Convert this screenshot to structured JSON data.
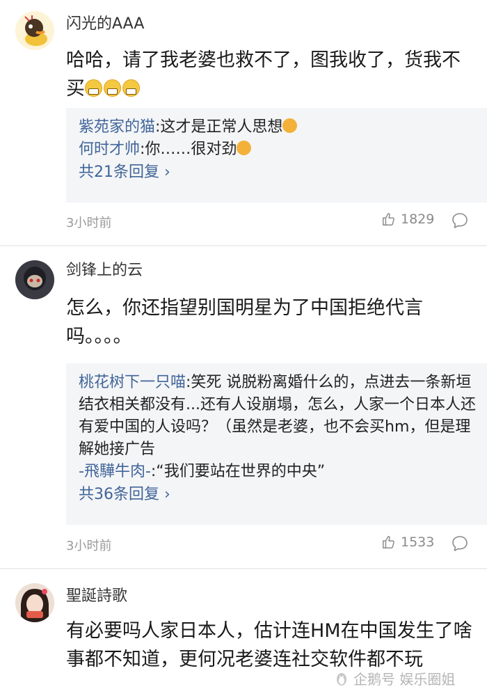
{
  "comments": [
    {
      "username": "闪光的AAA",
      "content": "哈哈，请了我老婆也救不了，图我收了，货我不买",
      "replies": [
        {
          "user": "紫苑家的猫",
          "text": ":这才是正常人思想"
        },
        {
          "user": "何时才帅",
          "text": ":你……很对劲"
        }
      ],
      "more_replies": "共21条回复",
      "time": "3小时前",
      "likes": "1829"
    },
    {
      "username": "剑锋上的云",
      "content": "怎么，你还指望别国明星为了中国拒绝代言吗。。。。",
      "replies": [
        {
          "user": "桃花树下一只喵",
          "text": ":笑死 说脱粉离婚什么的，点进去一条新垣结衣相关都没有...还有人设崩塌，怎么，人家一个日本人还有爱中国的人设吗？（虽然是老婆，也不会买hm，但是理解她接广告"
        },
        {
          "user": "-飛驊牛肉-",
          "text": ":“我们要站在世界的中央”"
        }
      ],
      "more_replies": "共36条回复",
      "time": "3小时前",
      "likes": "1533"
    },
    {
      "username": "聖誕詩歌",
      "content": "有必要吗人家日本人，估计连HM在中国发生了啥事都不知道，更何况老婆连社交软件都不玩"
    }
  ],
  "watermark": "企鹅号 娱乐圈姐",
  "colors": {
    "link": "#406599",
    "reply_bg": "#f4f5f7",
    "meta": "#9a9a9a"
  }
}
